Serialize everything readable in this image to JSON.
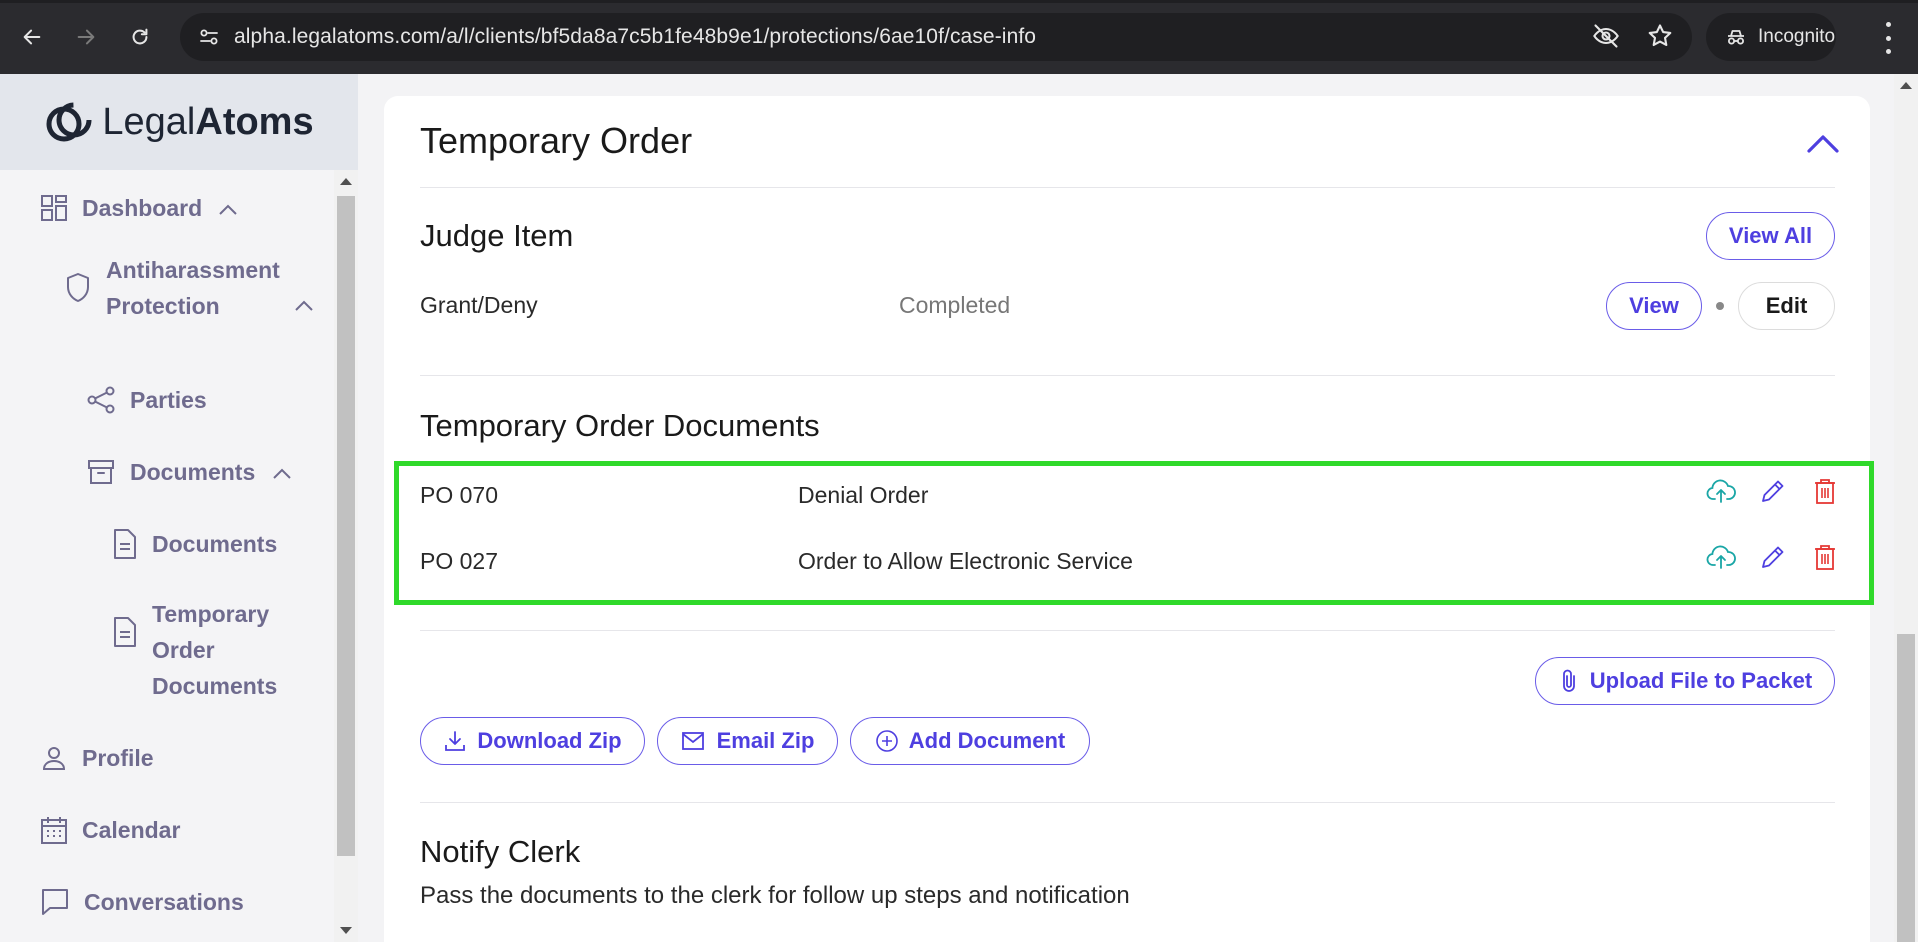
{
  "browser": {
    "url": "alpha.legalatoms.com/a/l/clients/bf5da8a7c5b1fe48b9e1/protections/6ae10f/case-info",
    "incognito_label": "Incognito"
  },
  "logo": {
    "part1": "Legal",
    "part2": "Atoms"
  },
  "sidebar": {
    "dashboard": "Dashboard",
    "protection_line1": "Antiharassment",
    "protection_line2": "Protection",
    "parties": "Parties",
    "documents_group": "Documents",
    "documents_sub": "Documents",
    "temp_line1": "Temporary",
    "temp_line2": "Order",
    "temp_line3": "Documents",
    "profile": "Profile",
    "calendar": "Calendar",
    "conversations": "Conversations"
  },
  "main": {
    "section_title": "Temporary Order",
    "judge": {
      "title": "Judge Item",
      "view_all": "View All",
      "item_name": "Grant/Deny",
      "item_status": "Completed",
      "view": "View",
      "edit": "Edit"
    },
    "documents": {
      "title": "Temporary Order Documents",
      "rows": [
        {
          "code": "PO 070",
          "name": "Denial Order"
        },
        {
          "code": "PO 027",
          "name": "Order to Allow Electronic Service"
        }
      ],
      "upload": "Upload File to Packet",
      "download_zip": "Download Zip",
      "email_zip": "Email Zip",
      "add_document": "Add Document"
    },
    "notify": {
      "title": "Notify Clerk",
      "description": "Pass the documents to the clerk for follow up steps and notification"
    }
  },
  "colors": {
    "accent": "#4e3fe0",
    "highlight": "#2fd92a",
    "upload_icon": "#1aa6a6",
    "delete_icon": "#e53935",
    "sidebar_text": "#6f6b8e"
  }
}
